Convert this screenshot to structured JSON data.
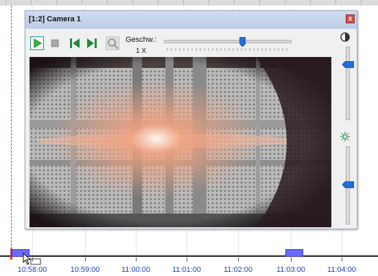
{
  "window": {
    "title": "[1:2] Camera 1",
    "close_glyph": "x"
  },
  "toolbar": {
    "play_icon": "play-icon",
    "stop_icon": "stop-icon",
    "skip_back_icon": "skip-back-icon",
    "skip_forward_icon": "skip-forward-icon",
    "zoom_icon": "zoom-icon",
    "speed_label": "Geschw.:",
    "speed_value": "1 X",
    "speed_fraction": 0.62
  },
  "adjustments": {
    "contrast_icon": "contrast-icon",
    "brightness_icon": "brightness-icon",
    "contrast_fraction": 0.25,
    "brightness_fraction": 0.5
  },
  "timeline": {
    "labels": [
      "10:58:00",
      "10:59:00",
      "11:00:00",
      "11:01:00",
      "11:02:00",
      "11:03:00",
      "11:04:00"
    ],
    "colors": {
      "segment": "#6b6bff",
      "marker": "#e03030",
      "label": "#1f3fb3"
    }
  }
}
